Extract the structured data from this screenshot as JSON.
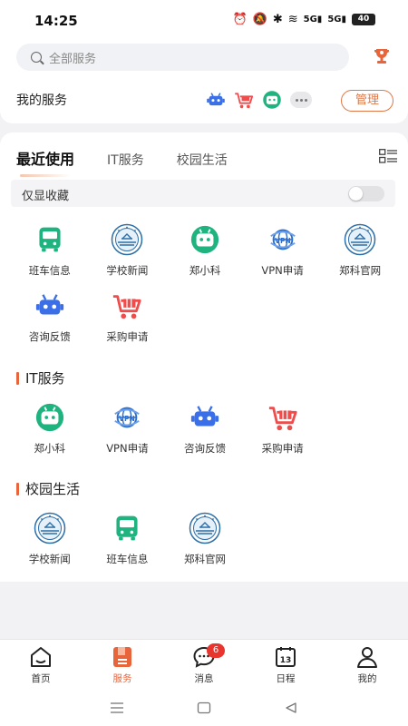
{
  "status_bar": {
    "time": "14:25",
    "battery": "40",
    "signal_label": "5G"
  },
  "search": {
    "placeholder": "全部服务"
  },
  "my_services": {
    "title": "我的服务",
    "manage_label": "管理"
  },
  "tabs": [
    {
      "label": "最近使用",
      "active": true
    },
    {
      "label": "IT服务",
      "active": false
    },
    {
      "label": "校园生活",
      "active": false
    }
  ],
  "favorites_toggle": {
    "label": "仅显收藏",
    "on": false
  },
  "recent_items": [
    {
      "label": "班车信息",
      "icon": "bus-icon"
    },
    {
      "label": "学校新闻",
      "icon": "school-emblem-icon"
    },
    {
      "label": "郑小科",
      "icon": "robot-green-icon"
    },
    {
      "label": "VPN申请",
      "icon": "vpn-globe-icon"
    },
    {
      "label": "郑科官网",
      "icon": "school-emblem-icon"
    },
    {
      "label": "咨询反馈",
      "icon": "robot-blue-icon"
    },
    {
      "label": "采购申请",
      "icon": "shopping-cart-icon"
    }
  ],
  "sections": [
    {
      "title": "IT服务",
      "items": [
        {
          "label": "郑小科",
          "icon": "robot-green-icon"
        },
        {
          "label": "VPN申请",
          "icon": "vpn-globe-icon"
        },
        {
          "label": "咨询反馈",
          "icon": "robot-blue-icon"
        },
        {
          "label": "采购申请",
          "icon": "shopping-cart-icon"
        }
      ]
    },
    {
      "title": "校园生活",
      "items": [
        {
          "label": "学校新闻",
          "icon": "school-emblem-icon"
        },
        {
          "label": "班车信息",
          "icon": "bus-icon"
        },
        {
          "label": "郑科官网",
          "icon": "school-emblem-icon"
        }
      ]
    }
  ],
  "bottom_nav": [
    {
      "label": "首页",
      "icon": "home-icon",
      "active": false
    },
    {
      "label": "服务",
      "icon": "service-icon",
      "active": true
    },
    {
      "label": "消息",
      "icon": "message-icon",
      "active": false,
      "badge": "6"
    },
    {
      "label": "日程",
      "icon": "calendar-icon",
      "active": false,
      "calendar_day": "13"
    },
    {
      "label": "我的",
      "icon": "profile-icon",
      "active": false
    }
  ],
  "colors": {
    "accent": "#e8653c",
    "green": "#1fb37f",
    "blue": "#3a6fe8",
    "red": "#f04c4c"
  }
}
